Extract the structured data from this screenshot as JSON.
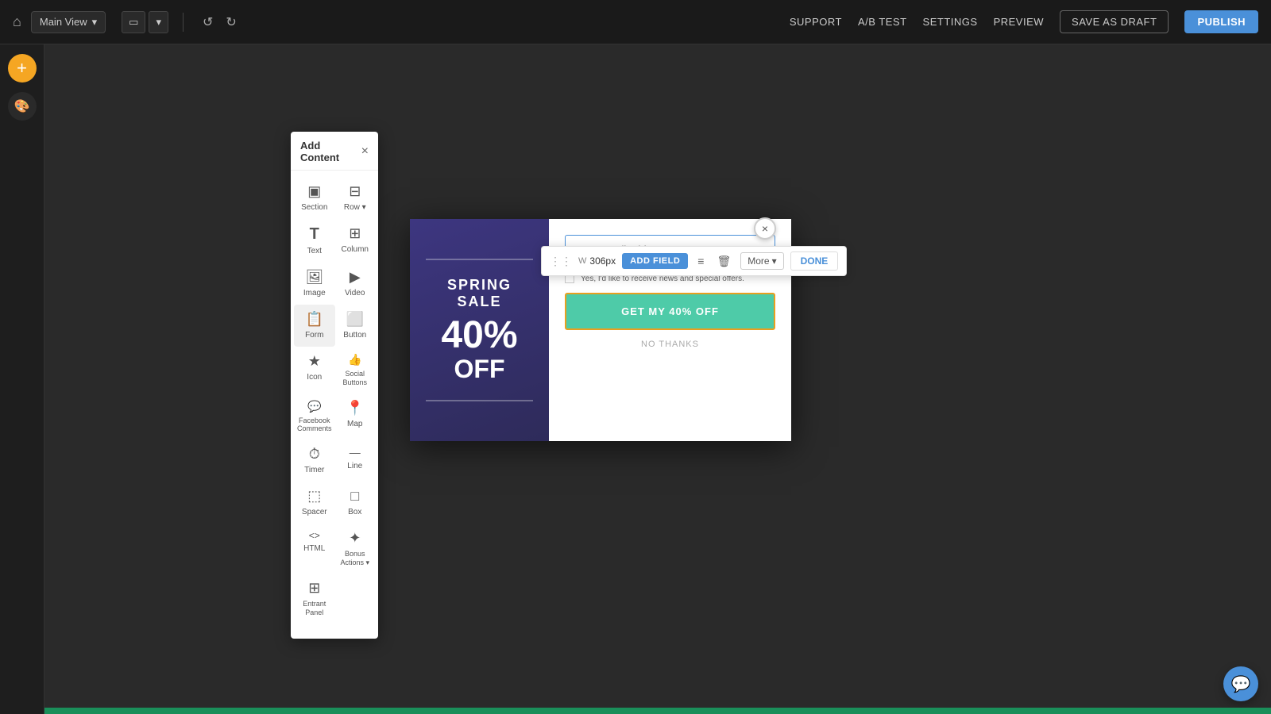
{
  "topNav": {
    "homeIcon": "⌂",
    "viewSelector": "Main View",
    "viewSelectorArrow": "▾",
    "deviceIcons": [
      "▭",
      "▾"
    ],
    "undoIcon": "↺",
    "redoIcon": "↻",
    "support": "SUPPORT",
    "abTest": "A/B TEST",
    "settings": "SETTINGS",
    "preview": "PREVIEW",
    "saveDraft": "SAVE AS DRAFT",
    "publish": "PUBLISH"
  },
  "leftSidebar": {
    "addIcon": "+",
    "paletteIcon": "🎨"
  },
  "addContentPanel": {
    "title": "Add Content",
    "closeIcon": "×",
    "items": [
      {
        "icon": "▣",
        "label": "Section",
        "hasArrow": true
      },
      {
        "icon": "⊟",
        "label": "Row ▾",
        "hasArrow": true
      },
      {
        "icon": "T",
        "label": "Text",
        "hasArrow": false
      },
      {
        "icon": "⊞",
        "label": "Column",
        "hasArrow": false
      },
      {
        "icon": "🖼",
        "label": "Image",
        "hasArrow": false
      },
      {
        "icon": "▶",
        "label": "Video",
        "hasArrow": false
      },
      {
        "icon": "📋",
        "label": "Form",
        "hasArrow": false
      },
      {
        "icon": "⬜",
        "label": "Button",
        "hasArrow": false
      },
      {
        "icon": "★",
        "label": "Icon",
        "hasArrow": false
      },
      {
        "icon": "👍",
        "label": "Social Buttons",
        "hasArrow": false
      },
      {
        "icon": "💬",
        "label": "Facebook Comments",
        "hasArrow": false
      },
      {
        "icon": "📍",
        "label": "Map",
        "hasArrow": false
      },
      {
        "icon": "⏱",
        "label": "Timer",
        "hasArrow": false
      },
      {
        "icon": "—",
        "label": "Line",
        "hasArrow": false
      },
      {
        "icon": "⬚",
        "label": "Spacer",
        "hasArrow": false
      },
      {
        "icon": "□",
        "label": "Box",
        "hasArrow": false
      },
      {
        "icon": "<>",
        "label": "HTML",
        "hasArrow": false
      },
      {
        "icon": "✦",
        "label": "Bonus Actions ▾",
        "hasArrow": true
      },
      {
        "icon": "⊞",
        "label": "Entrant Panel",
        "hasArrow": false
      }
    ]
  },
  "popup": {
    "left": {
      "springSale": "SPRING SALE",
      "discount": "40%",
      "off": "OFF"
    },
    "right": {
      "emailPlaceholder": "enter email address",
      "checkboxLabel": "Yes, I'd like to receive news and special offers.",
      "ctaButton": "GET MY 40% OFF",
      "noThanks": "NO THANKS"
    }
  },
  "formToolbar": {
    "dragHandle": "⋮⋮",
    "widthLabel": "W",
    "widthValue": "306px",
    "addFieldBtn": "ADD FIELD",
    "listIcon": "≡",
    "deleteIcon": "🗑",
    "moreLabel": "More",
    "moreArrow": "▾",
    "doneBtn": "DONE",
    "closeIcon": "×"
  },
  "chatWidget": {
    "icon": "💬"
  },
  "colors": {
    "publishBlue": "#4a90d9",
    "addBtnOrange": "#f5a623",
    "ctaGreen": "#4ecba8",
    "popupLeftBg": "#3d3680",
    "navBg": "#1a1a1a",
    "canvasBg": "#2a2a2a",
    "bottomBar": "#1a8f5a"
  }
}
